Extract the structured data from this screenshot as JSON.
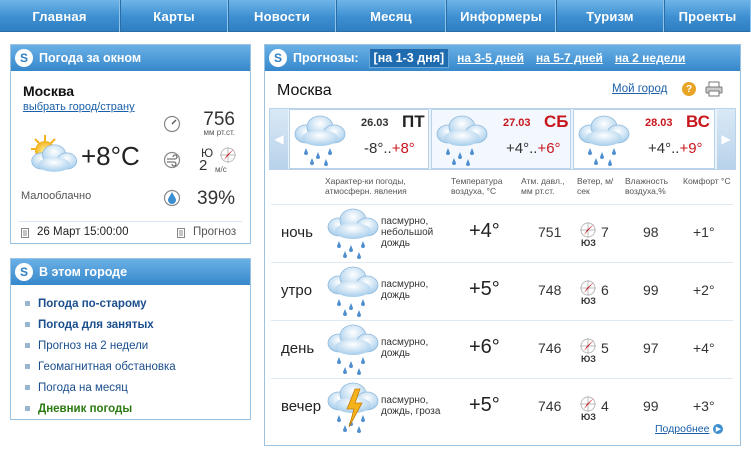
{
  "nav": [
    "Главная",
    "Карты",
    "Новости",
    "Месяц",
    "Информеры",
    "Туризм",
    "Проекты"
  ],
  "current": {
    "title": "Погода за окном",
    "badge": "S",
    "city": "Москва",
    "choose_city": "выбрать город/страну",
    "temp": "+8°C",
    "pressure": "756",
    "pressure_unit": "мм рт.ст.",
    "wind_dir": "Ю",
    "wind_speed": "2",
    "wind_unit": "м/с",
    "humidity": "39%",
    "description": "Малооблачно",
    "datetime": "26 Март 15:00:00",
    "forecast_link": "Прогноз"
  },
  "city_panel": {
    "title": "В этом городе",
    "badge": "S",
    "items": [
      {
        "label": "Погода по-старому"
      },
      {
        "label": "Погода для занятых"
      },
      {
        "label": "Прогноз на 2 недели"
      },
      {
        "label": "Геомагнитная обстановка"
      },
      {
        "label": "Погода на месяц"
      },
      {
        "label": "Дневник погоды"
      }
    ]
  },
  "forecast": {
    "title": "Прогнозы:",
    "badge": "S",
    "tabs": {
      "active": "[на 1-3 дня]",
      "t2": "на 3-5 дней",
      "t3": "на 5-7 дней",
      "t4": "на 2 недели"
    },
    "city": "Москва",
    "my_city": "Мой город",
    "help": "?",
    "days": [
      {
        "date": "26.03",
        "weekday": "ПТ",
        "lo": "-8°",
        "hi": "+8°",
        "sep": ".."
      },
      {
        "date": "27.03",
        "weekday": "СБ",
        "lo": "+4°",
        "hi": "+6°",
        "sep": ".."
      },
      {
        "date": "28.03",
        "weekday": "ВС",
        "lo": "+4°",
        "hi": "+9°",
        "sep": ".."
      }
    ],
    "headers": {
      "cond": "Характер-ки погоды, атмосферн. явления",
      "temp": "Температура воздуха, °С",
      "press": "Атм. давл., мм рт.ст.",
      "wind": "Ветер, м/сек",
      "hum": "Влажность воздуха,%",
      "comf": "Комфорт °С"
    },
    "rows": [
      {
        "period": "ночь",
        "cond": "пасмурно, небольшой дождь",
        "temp": "+4°",
        "press": "751",
        "wind_dir": "ЮЗ",
        "wind": "7",
        "hum": "98",
        "comfort": "+1°"
      },
      {
        "period": "утро",
        "cond": "пасмурно, дождь",
        "temp": "+5°",
        "press": "748",
        "wind_dir": "ЮЗ",
        "wind": "6",
        "hum": "99",
        "comfort": "+2°"
      },
      {
        "period": "день",
        "cond": "пасмурно, дождь",
        "temp": "+6°",
        "press": "746",
        "wind_dir": "ЮЗ",
        "wind": "5",
        "hum": "97",
        "comfort": "+4°"
      },
      {
        "period": "вечер",
        "cond": "пасмурно, дождь, гроза",
        "temp": "+5°",
        "press": "746",
        "wind_dir": "ЮЗ",
        "wind": "4",
        "hum": "99",
        "comfort": "+3°"
      }
    ],
    "more": "Подробнее"
  }
}
